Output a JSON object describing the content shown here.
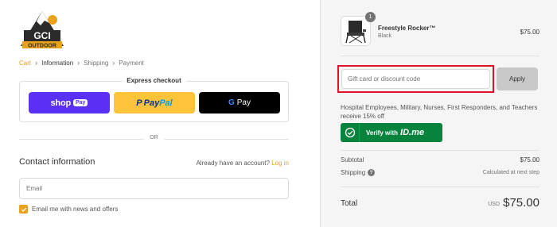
{
  "logo": {
    "text_top": "GCI",
    "text_bottom": "OUTDOOR"
  },
  "breadcrumb": [
    {
      "label": "Cart",
      "state": "link"
    },
    {
      "label": "Information",
      "state": "active"
    },
    {
      "label": "Shipping",
      "state": "muted"
    },
    {
      "label": "Payment",
      "state": "muted"
    }
  ],
  "express": {
    "title": "Express checkout",
    "shop_pay": {
      "text": "shop",
      "pill": "Pay"
    },
    "paypal": {
      "part1": "Pay",
      "part2": "Pal"
    },
    "gpay": {
      "g": "G",
      "text": "Pay"
    }
  },
  "divider": {
    "text": "OR"
  },
  "contact": {
    "title": "Contact information",
    "account_prompt": "Already have an account?",
    "login_label": "Log in",
    "email_placeholder": "Email",
    "optin_label": "Email me with news and offers",
    "optin_checked": true
  },
  "cart": {
    "item": {
      "name": "Freestyle Rocker™",
      "variant": "Black",
      "price": "$75.00",
      "quantity": "1",
      "image_icon": "camp-chair-icon"
    },
    "discount": {
      "placeholder": "Gift card or discount code",
      "apply_label": "Apply"
    },
    "promo_text": "Hospital Employees, Military, Nurses, First Responders, and Teachers receive 15% off",
    "idme": {
      "prefix": "Verify with",
      "brand": "ID.me"
    },
    "summary": {
      "subtotal_label": "Subtotal",
      "subtotal_value": "$75.00",
      "shipping_label": "Shipping",
      "shipping_value": "Calculated at next step",
      "total_label": "Total",
      "currency": "USD",
      "total_value": "$75.00"
    }
  },
  "colors": {
    "accent": "#e8a21b",
    "shop_pay": "#5a31f4",
    "paypal": "#ffc439",
    "idme_green": "#08833d",
    "highlight_red": "#e0132a"
  }
}
